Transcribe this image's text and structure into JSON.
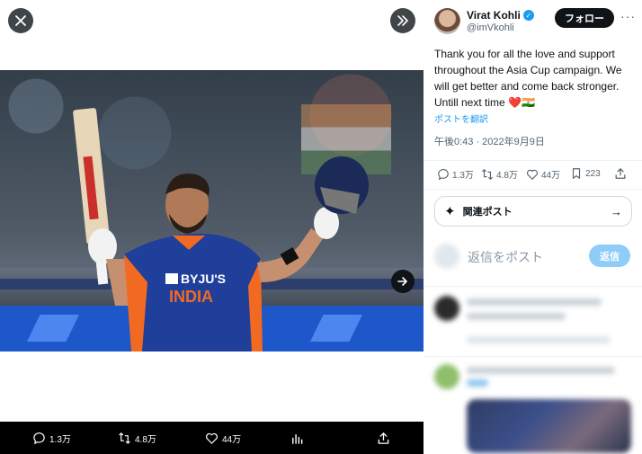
{
  "media": {
    "close_icon": "close-icon",
    "expand_icon": "expand-icon",
    "next_icon": "arrow-right-icon",
    "actions": {
      "replies": "1.3万",
      "reposts": "4.8万",
      "likes": "44万"
    }
  },
  "tweet": {
    "author_name": "Virat Kohli",
    "author_handle": "@imVkohli",
    "follow_label": "フォロー",
    "more_label": "···",
    "text": "Thank you for all the love and support throughout the Asia Cup campaign. We will get better and come back stronger. Untill next time ❤️🇮🇳",
    "translate_label": "ポストを翻訳",
    "timestamp": "午後0:43 · 2022年9月9日",
    "stats": {
      "replies": "1.3万",
      "reposts": "4.8万",
      "likes": "44万",
      "bookmarks": "223"
    },
    "related_label": "関連ポスト",
    "reply_placeholder": "返信をポスト",
    "reply_button": "返信"
  },
  "colors": {
    "accent": "#1d9bf0",
    "reply_button_disabled": "#8ecdf8",
    "like_heart": "#f91880"
  }
}
